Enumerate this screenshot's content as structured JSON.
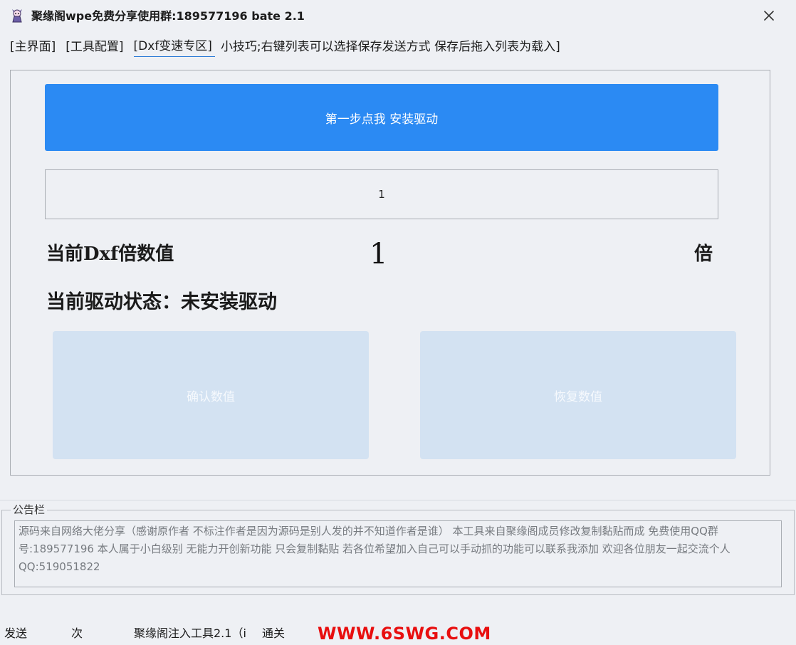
{
  "window": {
    "title": "聚缘阁wpe免费分享使用群:189577196 bate 2.1",
    "app_icon": "cartoon-character-icon",
    "close_icon": "close-icon"
  },
  "tabs": [
    {
      "label": "[主界面]"
    },
    {
      "label": "[工具配置]"
    },
    {
      "label": "[Dxf变速专区]",
      "active": true
    }
  ],
  "tip": "小技巧;右键列表可以选择保存发送方式 保存后拖入列表为载入]",
  "main": {
    "install_button_label": "第一步点我 安装驱动",
    "value_input": "1",
    "multiplier_label": "当前Dxf倍数值",
    "multiplier_value": "1",
    "multiplier_unit": "倍",
    "driver_status": "当前驱动状态：未安装驱动",
    "confirm_button_label": "确认数值",
    "restore_button_label": "恢复数值"
  },
  "notice": {
    "legend": "公告栏",
    "text": "源码来自网络大佬分享（感谢原作者 不标注作者是因为源码是别人发的并不知道作者是谁） 本工具来自聚缘阁成员修改复制黏贴而成 免费使用QQ群号:189577196 本人属于小白级别 无能力开创新功能 只会复制黏贴 若各位希望加入自己可以手动抓的功能可以联系我添加 欢迎各位朋友一起交流个人QQ:519051822"
  },
  "statusbar": {
    "send": "发送",
    "count": "次",
    "tool": "聚缘阁注入工具2.1（i",
    "pass": "通关",
    "watermark": "WWW.6SWG.COM"
  },
  "colors": {
    "accent_blue": "#2b8af3",
    "disabled_button": "#d3e2f2",
    "watermark_red": "#e80f0f",
    "background": "#eef0f4"
  }
}
